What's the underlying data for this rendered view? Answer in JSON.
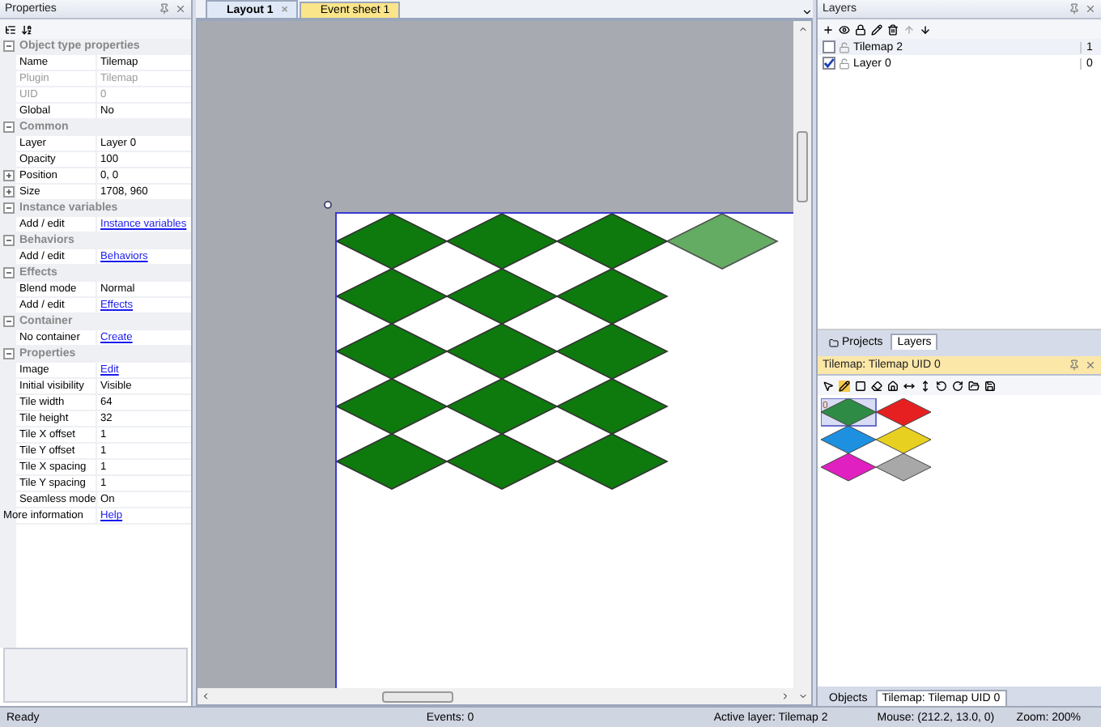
{
  "properties": {
    "title": "Properties",
    "rows": [
      {
        "kind": "section",
        "label": "Object type properties",
        "expanded": true
      },
      {
        "kind": "prop",
        "name": "Name",
        "value": "Tilemap",
        "disabled": false
      },
      {
        "kind": "prop",
        "name": "Plugin",
        "value": "Tilemap",
        "disabled": true
      },
      {
        "kind": "prop",
        "name": "UID",
        "value": "0",
        "disabled": true
      },
      {
        "kind": "prop",
        "name": "Global",
        "value": "No",
        "disabled": false
      },
      {
        "kind": "section",
        "label": "Common",
        "expanded": true
      },
      {
        "kind": "prop",
        "name": "Layer",
        "value": "Layer 0",
        "disabled": false
      },
      {
        "kind": "prop",
        "name": "Opacity",
        "value": "100",
        "disabled": false
      },
      {
        "kind": "prop",
        "name": "Position",
        "value": "0, 0",
        "disabled": false,
        "expanded": false
      },
      {
        "kind": "prop",
        "name": "Size",
        "value": "1708, 960",
        "disabled": false,
        "expanded": false
      },
      {
        "kind": "section",
        "label": "Instance variables",
        "expanded": true
      },
      {
        "kind": "link",
        "name": "Add / edit",
        "value": "Instance variables"
      },
      {
        "kind": "section",
        "label": "Behaviors",
        "expanded": true
      },
      {
        "kind": "link",
        "name": "Add / edit",
        "value": "Behaviors"
      },
      {
        "kind": "section",
        "label": "Effects",
        "expanded": true
      },
      {
        "kind": "prop",
        "name": "Blend mode",
        "value": "Normal",
        "disabled": false
      },
      {
        "kind": "link",
        "name": "Add / edit",
        "value": "Effects"
      },
      {
        "kind": "section",
        "label": "Container",
        "expanded": true
      },
      {
        "kind": "link",
        "name": "No container",
        "value": "Create"
      },
      {
        "kind": "section",
        "label": "Properties",
        "expanded": true
      },
      {
        "kind": "link",
        "name": "Image",
        "value": "Edit"
      },
      {
        "kind": "prop",
        "name": "Initial visibility",
        "value": "Visible",
        "disabled": false
      },
      {
        "kind": "prop",
        "name": "Tile width",
        "value": "64",
        "disabled": false
      },
      {
        "kind": "prop",
        "name": "Tile height",
        "value": "32",
        "disabled": false
      },
      {
        "kind": "prop",
        "name": "Tile X offset",
        "value": "1",
        "disabled": false
      },
      {
        "kind": "prop",
        "name": "Tile Y offset",
        "value": "1",
        "disabled": false
      },
      {
        "kind": "prop",
        "name": "Tile X spacing",
        "value": "1",
        "disabled": false
      },
      {
        "kind": "prop",
        "name": "Tile Y spacing",
        "value": "1",
        "disabled": false
      },
      {
        "kind": "prop",
        "name": "Seamless mode",
        "value": "On",
        "disabled": false
      },
      {
        "kind": "top",
        "name": "More information",
        "value": "Help"
      }
    ]
  },
  "editor_tabs": [
    {
      "label": "Layout 1",
      "close": "×",
      "selected": true,
      "color": "#dfe8f6"
    },
    {
      "label": "Event sheet 1",
      "selected": false,
      "color": "#fbe58a"
    }
  ],
  "layers": {
    "title": "Layers",
    "rows": [
      {
        "name": "Tilemap 2",
        "visible": false,
        "selected": true,
        "index": "1"
      },
      {
        "name": "Layer 0",
        "visible": true,
        "selected": false,
        "index": "0"
      }
    ]
  },
  "side_tabs": [
    {
      "label": "Projects",
      "selected": false
    },
    {
      "label": "Layers",
      "selected": true
    }
  ],
  "tilemap": {
    "title": "Tilemap: Tilemap UID 0",
    "selected_tile": "0",
    "palette": [
      {
        "color": "#2e8b45",
        "selected": true
      },
      {
        "color": "#e62020",
        "selected": false
      },
      {
        "color": "#1e90e0",
        "selected": false
      },
      {
        "color": "#e8d020",
        "selected": false
      },
      {
        "color": "#e020c0",
        "selected": false
      },
      {
        "color": "#a8a8a8",
        "selected": false
      }
    ]
  },
  "bottom_tabs": [
    {
      "label": "Objects",
      "selected": false
    },
    {
      "label": "Tilemap: Tilemap UID 0",
      "selected": true
    }
  ],
  "status_bar": [
    "Ready",
    "Events: 0",
    "Active layer: Tilemap 2",
    "Mouse: (212.2, 13.0, 0)",
    "Zoom: 200%"
  ]
}
